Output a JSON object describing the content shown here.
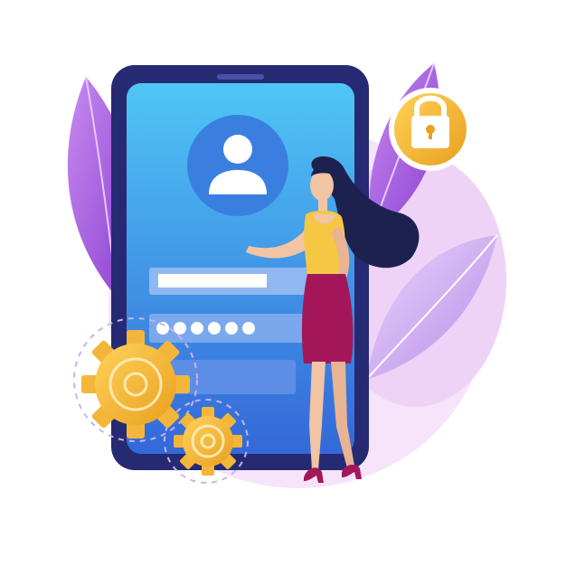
{
  "illustration": {
    "subject": "mobile-login",
    "colors": {
      "phone_body": "#2a2f7a",
      "screen_top": "#4fc6f5",
      "screen_bottom": "#2f6fd6",
      "accent_purple": "#9b4fd6",
      "leaf_light": "#d9c2f5",
      "blob_pink": "#f2dcf8",
      "gold": "#f4b934",
      "gold_dark": "#d98a1a",
      "lock_circle": "#f7c23e",
      "skirt": "#a8145c",
      "top_shirt": "#f5c843",
      "hair": "#1c1f4d",
      "skin": "#f3c6a8"
    },
    "icons": {
      "avatar": "user-avatar-icon",
      "lock": "padlock-icon",
      "gear_large": "gear-icon",
      "gear_small": "gear-icon"
    },
    "password_dots": 6
  }
}
